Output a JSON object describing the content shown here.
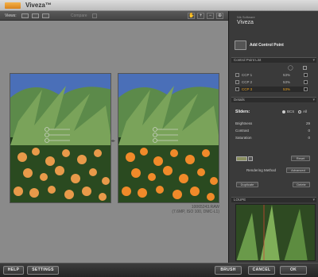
{
  "window": {
    "title": "Viveza™"
  },
  "toolbar": {
    "views_label": "Views:",
    "compare_label": "Compare",
    "tool_icons": [
      "hand-icon",
      "zoom-in-icon",
      "zoom-out-icon",
      "pin-icon"
    ]
  },
  "panel": {
    "brand_sub": "Nik Software",
    "brand_title": "Viveza",
    "add_control_point": "Add Control Point",
    "control_point_list": {
      "header": "Control Point List",
      "rows": [
        {
          "name": "CCP 1",
          "percent": "53%",
          "selected": false
        },
        {
          "name": "CCP 2",
          "percent": "53%",
          "selected": false
        },
        {
          "name": "CCP 3",
          "percent": "53%",
          "selected": true
        }
      ]
    },
    "details": {
      "header": "Details",
      "sliders_label": "Sliders:",
      "bcs_label": "BCS",
      "all_label": "All",
      "sliders": [
        {
          "name": "Brightness",
          "value": "29"
        },
        {
          "name": "Contrast",
          "value": "0"
        },
        {
          "name": "Saturation",
          "value": "0"
        }
      ],
      "reset_label": "Reset",
      "rendering_method_label": "Rendering Method",
      "rendering_method_value": "Advanced",
      "duplicate_label": "Duplicate",
      "delete_label": "Delete"
    },
    "loupe": {
      "header": "LOUPE"
    }
  },
  "image_info": {
    "filename": "10065243.RAW",
    "details": "(7.6MP, ISO 100, DMC-L1)"
  },
  "bottom": {
    "help": "HELP",
    "settings": "SETTINGS",
    "brush": "BRUSH",
    "cancel": "CANCEL",
    "ok": "OK"
  },
  "colors": {
    "selected_row": "#e8a020",
    "accent_orange": "#e8a020",
    "canvas_bg": "#8a8a8a",
    "panel_bg": "#3a3a3a"
  }
}
